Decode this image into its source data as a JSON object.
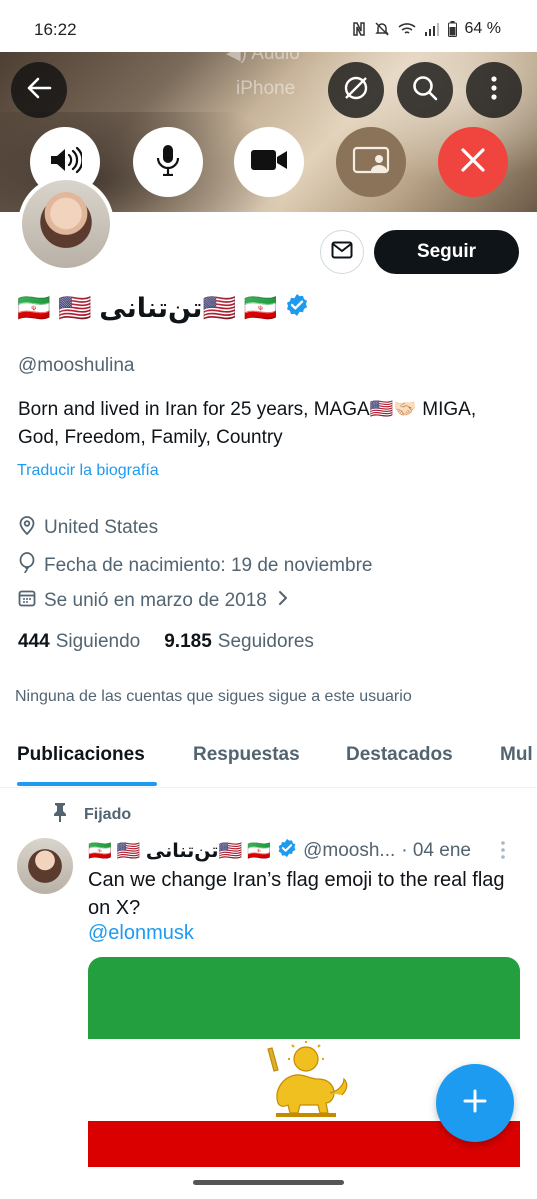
{
  "status_bar": {
    "time": "16:22",
    "battery": "64 %"
  },
  "call_overlay": {
    "audio_label": "Audio",
    "device_label": "iPhone"
  },
  "profile": {
    "display_name": "🇮🇷 🇺🇸 تن‌تنانی🇺🇸 🇮🇷",
    "handle": "@mooshulina",
    "bio": "Born and lived in Iran for 25 years,  MAGA🇺🇸🤝🏻 MIGA, God, Freedom, Family, Country",
    "translate_label": "Traducir la biografía",
    "location": "United States",
    "birthday": "Fecha de nacimiento: 19 de noviembre",
    "joined": "Se unió en marzo de 2018",
    "following_count": "444",
    "following_label": "Siguiendo",
    "followers_count": "9.185",
    "followers_label": "Seguidores",
    "followers_note": "Ninguna de las cuentas que sigues sigue a este usuario",
    "follow_label": "Seguir"
  },
  "tabs": [
    {
      "label": "Publicaciones",
      "active": true
    },
    {
      "label": "Respuestas",
      "active": false
    },
    {
      "label": "Destacados",
      "active": false
    },
    {
      "label": "Mul",
      "active": false
    }
  ],
  "post": {
    "pinned_label": "Fijado",
    "name": "🇮🇷 🇺🇸 تن‌تنانی🇺🇸 🇮🇷",
    "handle": "@moosh...",
    "date": "· 04 ene",
    "text": "Can we change Iran’s flag emoji to the real flag on X?",
    "mention": "@elonmusk"
  },
  "colors": {
    "accent": "#1d9bf0",
    "text_primary": "#0f1419",
    "text_secondary": "#536471",
    "end_call_red": "#f0443e"
  },
  "icons": [
    "back-arrow-icon",
    "no-translate-icon",
    "search-icon",
    "more-vertical-icon",
    "speaker-icon",
    "microphone-icon",
    "video-camera-icon",
    "screen-share-icon",
    "end-call-icon",
    "mail-icon",
    "verified-badge-icon",
    "location-icon",
    "balloon-icon",
    "calendar-icon",
    "chevron-right-icon",
    "pin-icon",
    "plus-icon"
  ]
}
